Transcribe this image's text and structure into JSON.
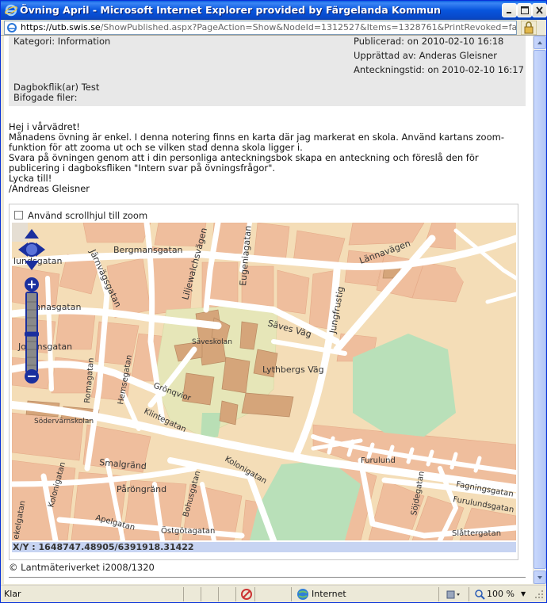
{
  "window": {
    "title": "Övning April - Microsoft Internet Explorer provided by Färgelanda Kommun"
  },
  "address": {
    "url_host": "https://utb.swis.se",
    "url_path": "/ShowPublished.aspx?PageAction=Show&NodeId=1312527&Items=1328761&PrintRevoked=false&IgnoreFilte"
  },
  "header": {
    "category": "Kategori: Information",
    "published": "Publicerad: on 2010-02-10 16:18",
    "created_by": "Upprättad av: Anderas Gleisner",
    "note_time": "Anteckningstid: on 2010-02-10 16:17",
    "diary_tabs": "Dagbokflik(ar) Test",
    "attachments": "Bifogade filer:"
  },
  "body": {
    "lines": [
      "Hej i vårvädret!",
      "Månadens övning är enkel. I denna notering finns en karta där jag markerat en skola. Använd kartans zoom-",
      "funktion för att zooma ut och se vilken stad denna skola ligger i.",
      "Svara på övningen genom att i din personliga anteckningsbok skapa en anteckning och föreslå den för",
      "publicering i dagboksfliken \"Intern svar på övningsfrågor\".",
      "Lycka till!",
      "/Andreas Gleisner"
    ]
  },
  "map": {
    "scroll_zoom_label": "Använd scrollhjul till zoom",
    "scroll_zoom_checked": false,
    "coordinates": "X/Y : 1648747.48905/6391918.31422",
    "copyright": "© Lantmäteriverket i2008/1320",
    "zoom_level_fraction": 0.45,
    "labels": {
      "bergmansgatan": "Bergmansgatan",
      "lannavagen": "Lännavägen",
      "lundsgatan": "lundsgatan",
      "jarnvagsgatan": "Järnvägsgatan",
      "liljewalchsvagen": "Liljewalchsvägen",
      "eugeniagatan": "Eugeniagatan",
      "jungfrustig": "Jungfrustig",
      "dianasgatan": "Dianasgatan",
      "savesvag": "Säves Väg",
      "saveskolan": "Säveskolan",
      "johansgatan": "Johansgatan",
      "lythbergsvag": "Lythbergs Väg",
      "romagatan": "Romagatan",
      "hemsegatan": "Hemsegatan",
      "gronqvior": "Grönqvior",
      "sodervarnskolan": "Södervärnskolan",
      "klintegatan": "Klintegatan",
      "furulund": "Furulund",
      "smalgrand": "Smalgränd",
      "kolonigatan_left": "Kolonigatan",
      "bohusgatan": "Bohusgatan",
      "kolonigatan_right": "Kolonigatan",
      "parongrand": "Påröngränd",
      "fagningsgatan": "Fagningsgatan",
      "furulundsgatan": "Furulundsgatan",
      "sojdegatan": "Söjdegatan",
      "apelgatan": "Apelgatan",
      "ostgotagatan": "Östgötagatan",
      "slattergatan": "Slåttergatan",
      "ekelgatan": "ekelgatan"
    }
  },
  "statusbar": {
    "status": "Klar",
    "zone": "Internet",
    "zoom": "100 %"
  },
  "colors": {
    "titlebar": "#0855dd",
    "map_residential": "#f4ddb7",
    "map_building": "#efb48f",
    "map_park": "#d6e8b8",
    "map_green": "#b7dcb0",
    "map_road": "#ffffff",
    "nav_control": "#1a2f9e",
    "coord_bar": "#c7d4f2"
  }
}
